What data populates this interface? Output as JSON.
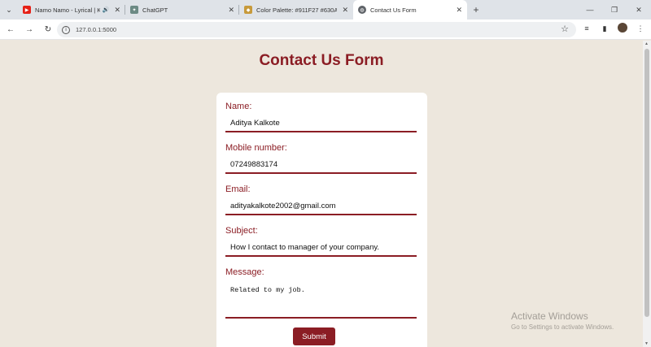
{
  "browser": {
    "tabs": [
      {
        "title": "Namo Namo - Lyrical | Ked",
        "icon": "youtube-icon",
        "color": "#e62117",
        "extra": "🔊"
      },
      {
        "title": "ChatGPT",
        "icon": "chatgpt-icon",
        "color": "#6c8a84",
        "extra": ""
      },
      {
        "title": "Color Palette: #911F27 #630A1",
        "icon": "palette-icon",
        "color": "#c79a3b",
        "extra": ""
      },
      {
        "title": "Contact Us Form",
        "icon": "globe-icon",
        "color": "#5f6368",
        "extra": ""
      }
    ],
    "url": "127.0.0.1:5000"
  },
  "page": {
    "title": "Contact Us Form",
    "accent_color": "#8b1d24"
  },
  "form": {
    "name_label": "Name:",
    "name_value": "Aditya Kalkote",
    "mobile_label": "Mobile number:",
    "mobile_value": "07249883174",
    "email_label": "Email:",
    "email_value": "adityakalkote2002@gmail.com",
    "subject_label": "Subject:",
    "subject_value": "How I contact to manager of your company.",
    "message_label": "Message:",
    "message_value": "Related to my job.",
    "submit_label": "Submit"
  },
  "watermark": {
    "line1": "Activate Windows",
    "line2": "Go to Settings to activate Windows."
  }
}
